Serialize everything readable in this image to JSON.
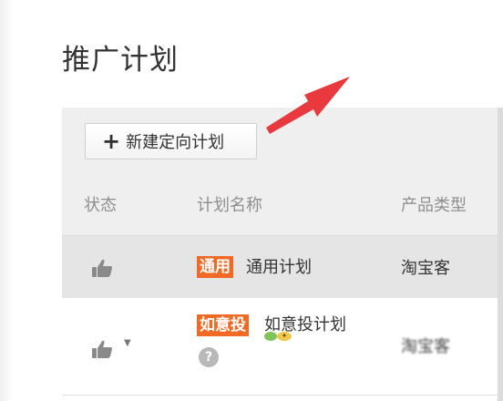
{
  "page": {
    "title": "推广计划"
  },
  "toolbar": {
    "new_plan_label": "新建定向计划",
    "plus_glyph": "+"
  },
  "table": {
    "columns": [
      "状态",
      "计划名称",
      "产品类型"
    ],
    "rows": [
      {
        "status_icon": "thumbs-up-icon",
        "badge": "通用",
        "name": "通用计划",
        "product_type": "淘宝客"
      },
      {
        "status_icon": "thumbs-up-icon",
        "badge": "如意投",
        "name": "如意投计划",
        "product_type": "淘宝客"
      }
    ],
    "help_glyph": "?"
  },
  "colors": {
    "badge": "#f06a25",
    "arrow": "#e8393e",
    "toolbar_bg": "#efefef",
    "header_text": "#8f8f8f"
  }
}
